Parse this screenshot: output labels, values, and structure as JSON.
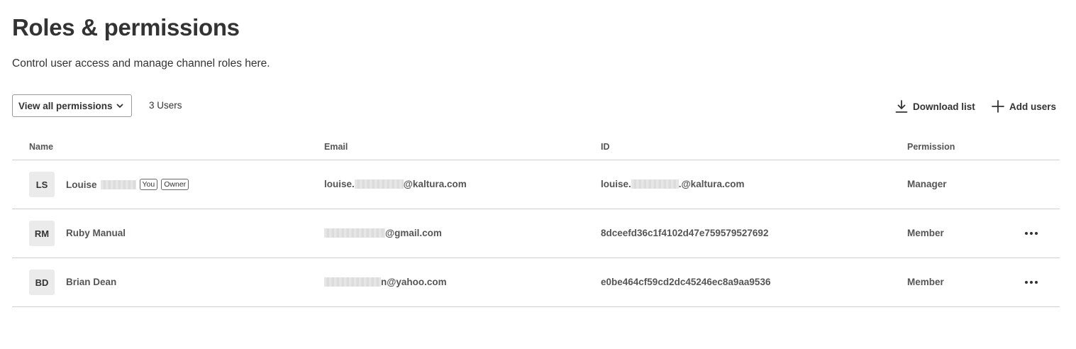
{
  "header": {
    "title": "Roles & permissions",
    "subtitle": "Control user access and manage channel roles here."
  },
  "toolbar": {
    "filter_label": "View all permissions",
    "user_count": "3 Users",
    "download_label": "Download list",
    "add_label": "Add users",
    "download_icon": "download-icon",
    "add_icon": "plus-icon"
  },
  "table": {
    "columns": [
      "Name",
      "Email",
      "ID",
      "Permission"
    ],
    "rows": [
      {
        "initials": "LS",
        "name": "Louise",
        "badges": [
          "You",
          "Owner"
        ],
        "email_prefix": "louise.",
        "email_suffix": "@kaltura.com",
        "id_prefix": "louise.",
        "id_suffix": ".@kaltura.com",
        "permission": "Manager"
      },
      {
        "initials": "RM",
        "name": "Ruby Manual",
        "email_prefix": "",
        "email_suffix": "@gmail.com",
        "id": "8dceefd36c1f4102d47e759579527692",
        "permission": "Member"
      },
      {
        "initials": "BD",
        "name": "Brian Dean",
        "email_prefix": "",
        "email_suffix": "n@yahoo.com",
        "id": "e0be464cf59cd2dc45246ec8a9aa9536",
        "permission": "Member"
      }
    ]
  }
}
